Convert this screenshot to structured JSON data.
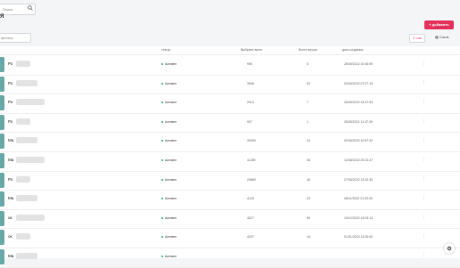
{
  "search": {
    "placeholder": "Поиск"
  },
  "page": {
    "title": "Я"
  },
  "toolbar": {
    "add_label": "+ добавить",
    "filter_placeholder": "фильтр",
    "list_label": "≡ List",
    "grid_label": "▦ Cards"
  },
  "columns": {
    "status": "статус",
    "size": "Выбрано всего",
    "inner": "Всего игроки",
    "date": "дата создания"
  },
  "rows": [
    {
      "name": "Ро",
      "status": "Активен",
      "size": "995",
      "count": "5",
      "date": "26/05/2022 10:46:59"
    },
    {
      "name": "Ро",
      "status": "Активен",
      "size": "3006",
      "count": "53",
      "date": "02/05/2022 07:27:19"
    },
    {
      "name": "Ро",
      "status": "Активен",
      "size": "2013",
      "count": "7",
      "date": "26/05/2022 14:47:53"
    },
    {
      "name": "Ро",
      "status": "Активен",
      "size": "997",
      "count": "1",
      "date": "26/05/2021 11:37:39"
    },
    {
      "name": "Ма",
      "status": "Активен",
      "size": "30900",
      "count": "24",
      "date": "02/06/2022 10:57:30"
    },
    {
      "name": "Ма",
      "status": "Активен",
      "size": "11289",
      "count": "36",
      "date": "12/08/2022 20:23:47"
    },
    {
      "name": "Ро",
      "status": "Активен",
      "size": "20869",
      "count": "46",
      "date": "27/06/2022 12:02:30"
    },
    {
      "name": "Ма",
      "status": "Активен",
      "size": "4133",
      "count": "23",
      "date": "08/11/2022 21:20:30"
    },
    {
      "name": "ок",
      "status": "Активен",
      "size": "4027",
      "count": "59",
      "date": "19/12/2022 13:03:14"
    },
    {
      "name": "ок",
      "status": "Активен",
      "size": "4207",
      "count": "16",
      "date": "01/01/2023 13:32:00"
    },
    {
      "name": "Ма",
      "status": "Активен",
      "size": "",
      "count": "",
      "date": ""
    }
  ],
  "colors": {
    "accent": "#e5335d",
    "active": "#2ab673",
    "thumb": "#6aa9a9"
  },
  "icons": {
    "search": "search-icon",
    "more": "more-vertical-icon",
    "settings": "gear-icon"
  }
}
